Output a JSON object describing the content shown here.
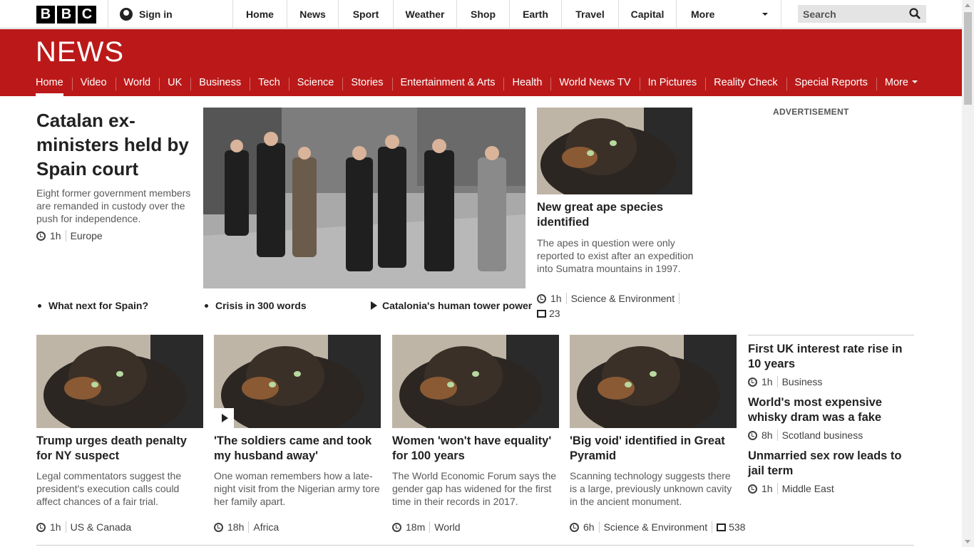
{
  "header": {
    "logo_letters": [
      "B",
      "B",
      "C"
    ],
    "signin_label": "Sign in",
    "nav": [
      {
        "label": "Home"
      },
      {
        "label": "News"
      },
      {
        "label": "Sport"
      },
      {
        "label": "Weather"
      },
      {
        "label": "Shop"
      },
      {
        "label": "Earth"
      },
      {
        "label": "Travel"
      },
      {
        "label": "Capital"
      }
    ],
    "more_label": "More",
    "search_placeholder": "Search"
  },
  "news_header": {
    "title": "NEWS",
    "subnav": [
      {
        "label": "Home",
        "active": true
      },
      {
        "label": "Video"
      },
      {
        "label": "World"
      },
      {
        "label": "UK"
      },
      {
        "label": "Business"
      },
      {
        "label": "Tech"
      },
      {
        "label": "Science"
      },
      {
        "label": "Stories"
      },
      {
        "label": "Entertainment & Arts"
      },
      {
        "label": "Health"
      },
      {
        "label": "World News TV"
      },
      {
        "label": "In Pictures"
      },
      {
        "label": "Reality Check"
      },
      {
        "label": "Special Reports"
      }
    ],
    "more_label": "More"
  },
  "lead": {
    "title": "Catalan ex-ministers held by Spain court",
    "summary": "Eight former government members are remanded in custody over the push for independence.",
    "time": "1h",
    "section": "Europe",
    "related": [
      "What next for Spain?",
      "Crisis in 300 words",
      "Catalonia's human tower power"
    ]
  },
  "secondary": {
    "title": "New great ape species identified",
    "summary": "The apes in question were only reported to exist after an expedition into Sumatra mountains in 1997.",
    "time": "1h",
    "section": "Science & Environment",
    "comments": "23"
  },
  "advertisement_label": "ADVERTISEMENT",
  "cards": [
    {
      "title": "Trump urges death penalty for NY suspect",
      "summary": "Legal commentators suggest the president's execution calls could affect chances of a fair trial.",
      "time": "1h",
      "section": "US & Canada",
      "video": false
    },
    {
      "title": "'The soldiers came and took my husband away'",
      "summary": "One woman remembers how a late-night visit from the Nigerian army tore her family apart.",
      "time": "18h",
      "section": "Africa",
      "video": true
    },
    {
      "title": "Women 'won't have equality' for 100 years",
      "summary": "The World Economic Forum says the gender gap has widened for the first time in their records in 2017.",
      "time": "18m",
      "section": "World",
      "video": false
    },
    {
      "title": "'Big void' identified in Great Pyramid",
      "summary": "Scanning technology suggests there is a large, previously unknown cavity in the ancient monument.",
      "time": "6h",
      "section": "Science & Environment",
      "comments": "538",
      "video": false
    }
  ],
  "sidebar": [
    {
      "title": "First UK interest rate rise in 10 years",
      "time": "1h",
      "section": "Business"
    },
    {
      "title": "World's most expensive whisky dram was a fake",
      "time": "8h",
      "section": "Scotland business"
    },
    {
      "title": "Unmarried sex row leads to jail term",
      "time": "1h",
      "section": "Middle East"
    }
  ],
  "colors": {
    "brand_red": "#bb1919",
    "text": "#222222",
    "muted": "#5a5a5a"
  }
}
